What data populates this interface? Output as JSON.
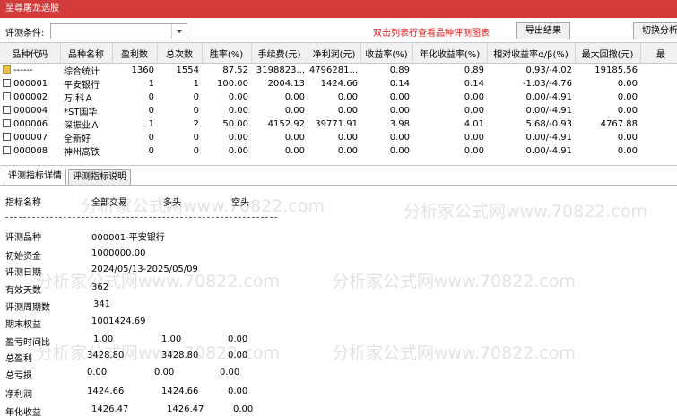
{
  "window": {
    "title": "至尊屠龙选股"
  },
  "toolbar": {
    "condition_label": "评测条件:",
    "condition_value": "",
    "hint": "双击列表行查看品种评测图表",
    "export_label": "导出结果",
    "switch_label": "切换分析"
  },
  "columns": [
    "品种代码",
    "品种名称",
    "盈利数",
    "总次数",
    "胜率(%)",
    "手续费(元)",
    "净利润(元)",
    "收益率(%)",
    "年化收益率(%)",
    "相对收益率α/β(%)",
    "最大回撤(元)",
    "最"
  ],
  "rows": [
    {
      "code": "------",
      "name": "综合统计",
      "profit": "1360",
      "total": "1554",
      "win": "87.52",
      "fee": "3198823...",
      "net": "4796281...",
      "ret": "0.89",
      "annual": "0.89",
      "rel": "0.93/-4.02",
      "dd": "19185.56"
    },
    {
      "code": "000001",
      "name": "平安银行",
      "profit": "1",
      "total": "1",
      "win": "100.00",
      "fee": "2004.13",
      "net": "1424.66",
      "ret": "0.14",
      "annual": "0.14",
      "rel": "-1.03/-4.76",
      "dd": "0.00"
    },
    {
      "code": "000002",
      "name": "万 科Ａ",
      "profit": "0",
      "total": "0",
      "win": "0.00",
      "fee": "0.00",
      "net": "0.00",
      "ret": "0.00",
      "annual": "0.00",
      "rel": "0.00/-4.91",
      "dd": "0.00"
    },
    {
      "code": "000004",
      "name": "*ST国华",
      "profit": "0",
      "total": "0",
      "win": "0.00",
      "fee": "0.00",
      "net": "0.00",
      "ret": "0.00",
      "annual": "0.00",
      "rel": "0.00/-4.91",
      "dd": "0.00"
    },
    {
      "code": "000006",
      "name": "深振业Ａ",
      "profit": "1",
      "total": "2",
      "win": "50.00",
      "fee": "4152.92",
      "net": "39771.91",
      "ret": "3.98",
      "annual": "4.01",
      "rel": "5.68/-0.93",
      "dd": "4767.88"
    },
    {
      "code": "000007",
      "name": "全新好",
      "profit": "0",
      "total": "0",
      "win": "0.00",
      "fee": "0.00",
      "net": "0.00",
      "ret": "0.00",
      "annual": "0.00",
      "rel": "0.00/-4.91",
      "dd": "0.00"
    },
    {
      "code": "000008",
      "name": "神州高铁",
      "profit": "0",
      "total": "0",
      "win": "0.00",
      "fee": "0.00",
      "net": "0.00",
      "ret": "0.00",
      "annual": "0.00",
      "rel": "0.00/-4.91",
      "dd": "0.00"
    }
  ],
  "tabs": [
    "评测指标详情",
    "评测指标说明"
  ],
  "detail": {
    "headers": [
      "指标名称",
      "全部交易",
      "多头",
      "空头"
    ],
    "items": [
      {
        "label": "评测品种",
        "v1": "000001-平安银行"
      },
      {
        "label": "初始资金",
        "v1": "1000000.00"
      },
      {
        "label": "评测日期",
        "v1": "2024/05/13-2025/05/09"
      },
      {
        "label": "有效天数",
        "v1": "362"
      },
      {
        "label": "评测周期数",
        "v1": "341"
      },
      {
        "label": "期末权益",
        "v1": "1001424.69"
      },
      {
        "label": "盈亏时间比",
        "v1": "1.00",
        "v2": "1.00",
        "v3": "0.00"
      },
      {
        "label": "总盈利",
        "v1": "3428.80",
        "v2": "3428.80",
        "v3": "0.00"
      },
      {
        "label": "总亏损",
        "v1": "0.00",
        "v2": "0.00",
        "v3": "0.00"
      },
      {
        "label": "净利润",
        "v1": "1424.66",
        "v2": "1424.66",
        "v3": "0.00"
      },
      {
        "label": "年化收益",
        "v1": "1426.47",
        "v2": "1426.47",
        "v3": "0.00"
      }
    ]
  },
  "watermark": "分析家公式网www.70822.com",
  "colors": {
    "title_bar": "#d33a3a",
    "hint": "#e01919"
  }
}
